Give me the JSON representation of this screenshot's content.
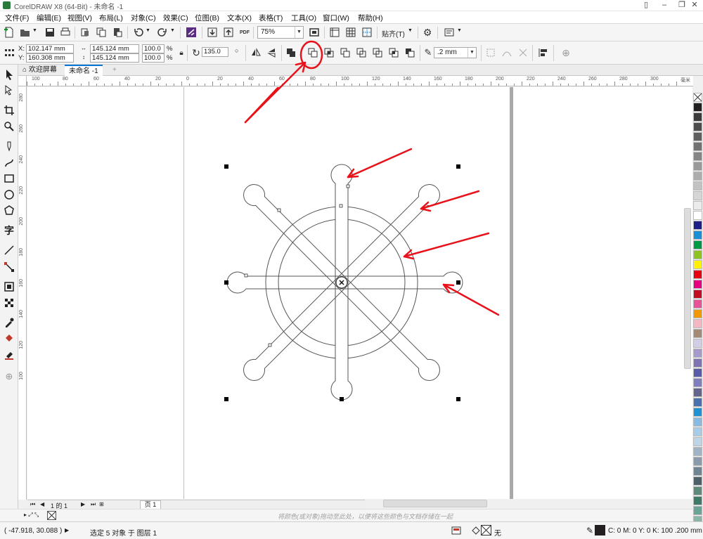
{
  "window": {
    "title": "CorelDRAW X8 (64-Bit) - 未命名 -1"
  },
  "menu": [
    "文件(F)",
    "编辑(E)",
    "视图(V)",
    "布局(L)",
    "对象(C)",
    "效果(C)",
    "位图(B)",
    "文本(X)",
    "表格(T)",
    "工具(O)",
    "窗口(W)",
    "帮助(H)"
  ],
  "standard_toolbar": {
    "pdf_label": "PDF",
    "zoom": "75%",
    "snap_label": "贴齐(T)"
  },
  "property_bar": {
    "x_label": "X:",
    "x_value": "102.147 mm",
    "y_label": "Y:",
    "y_value": "160.308 mm",
    "width": "145.124 mm",
    "height": "145.124 mm",
    "scale_w": "100.0",
    "scale_h": "100.0",
    "percent": "%",
    "rotation": "135.0",
    "outline_width": ".2 mm",
    "shaping_buttons": [
      "weld-icon",
      "trim-icon",
      "intersect-icon",
      "simplify-icon",
      "front-minus-back-icon",
      "back-minus-front-icon",
      "create-boundary-icon"
    ],
    "highlighted_button": "trim-icon"
  },
  "tabs": {
    "welcome": "欢迎屏幕",
    "document": "未命名 -1"
  },
  "ruler": {
    "h_labels": [
      "100",
      "80",
      "60",
      "40",
      "20",
      "0",
      "20",
      "40",
      "60",
      "80",
      "100",
      "120",
      "140",
      "160",
      "180",
      "200",
      "220",
      "240",
      "260",
      "280",
      "300"
    ],
    "unit": "毫米",
    "v_labels": [
      "280",
      "260",
      "240",
      "220",
      "200",
      "180",
      "160",
      "140",
      "120",
      "100"
    ]
  },
  "pagenav": {
    "counter": "1 的 1",
    "page_tab": "页 1"
  },
  "palette_hint": "将颜色(或对象)拖动至此处，以便将这些颜色与文档存储在一起",
  "status": {
    "coords": "( -47.918, 30.088 )",
    "selection": "选定 5 对象 于 图层 1",
    "fill_label": "无",
    "outline_info": "C: 0 M: 0 Y: 0 K: 100  .200 mm"
  },
  "colors": {
    "accent": "#0a78d7",
    "annotation_red": "#e8121b",
    "palette": [
      "#231f20",
      "#3c3a3a",
      "#4d4d4d",
      "#5f5f5f",
      "#727272",
      "#858585",
      "#999999",
      "#adadad",
      "#c2c2c2",
      "#d6d6d6",
      "#ebebeb",
      "#ffffff",
      "#1d2088",
      "#1a8fd8",
      "#009944",
      "#8fc31f",
      "#fff100",
      "#e60012",
      "#e4007f",
      "#c30d23",
      "#e85298",
      "#f39800",
      "#f4b6c2",
      "#a48b78",
      "#d2cce6",
      "#a59acb",
      "#8073b3",
      "#5a5ba8",
      "#7f7fbf",
      "#64658c",
      "#4c6fae",
      "#1e92d2",
      "#86bbe4",
      "#a6cce8",
      "#bcd4e6",
      "#9fb3c6",
      "#8a9bab",
      "#6f8594",
      "#4d6169",
      "#5d8a7b",
      "#3e7a6a",
      "#6aa496",
      "#8ab6a8"
    ]
  }
}
